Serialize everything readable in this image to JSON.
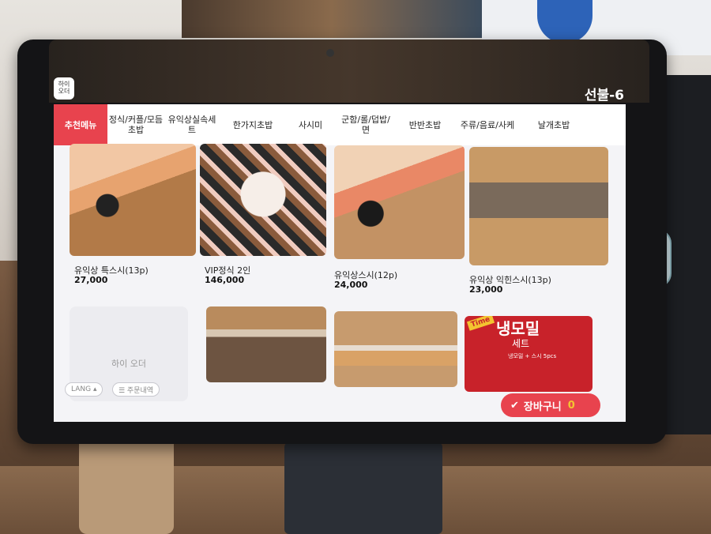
{
  "brand": {
    "logo_text": "하이\n오더"
  },
  "table_label": "선불-6",
  "tabs": [
    {
      "label": "추천메뉴",
      "active": true
    },
    {
      "label": "정식/커플/모듬\n초밥"
    },
    {
      "label": "유익상실속세\n트"
    },
    {
      "label": "한가지초밥"
    },
    {
      "label": "사시미"
    },
    {
      "label": "군함/롤/덥밥/\n면"
    },
    {
      "label": "반반초밥"
    },
    {
      "label": "주류/음료/사케"
    },
    {
      "label": "날개초밥"
    }
  ],
  "menu_items": [
    {
      "name": "유익상 특스시(13p)",
      "price": "27,000"
    },
    {
      "name": "VIP정식 2인",
      "price": "146,000"
    },
    {
      "name": "유익상스시(12p)",
      "price": "24,000"
    },
    {
      "name": "유익상 익힌스시(13p)",
      "price": "23,000"
    }
  ],
  "placeholder_label": "하이 오더",
  "promo": {
    "badge": "Time",
    "title": "냉모밀",
    "subtitle": "세트",
    "desc": "냉모밀 + 스시 5pcs"
  },
  "bottom": {
    "lang_label": "LANG ▴",
    "order_history_label": "☰ 주문내역"
  },
  "cart": {
    "label": "장바구니",
    "count": "0"
  },
  "colors": {
    "accent": "#e8434e",
    "badge": "#f3c431"
  }
}
